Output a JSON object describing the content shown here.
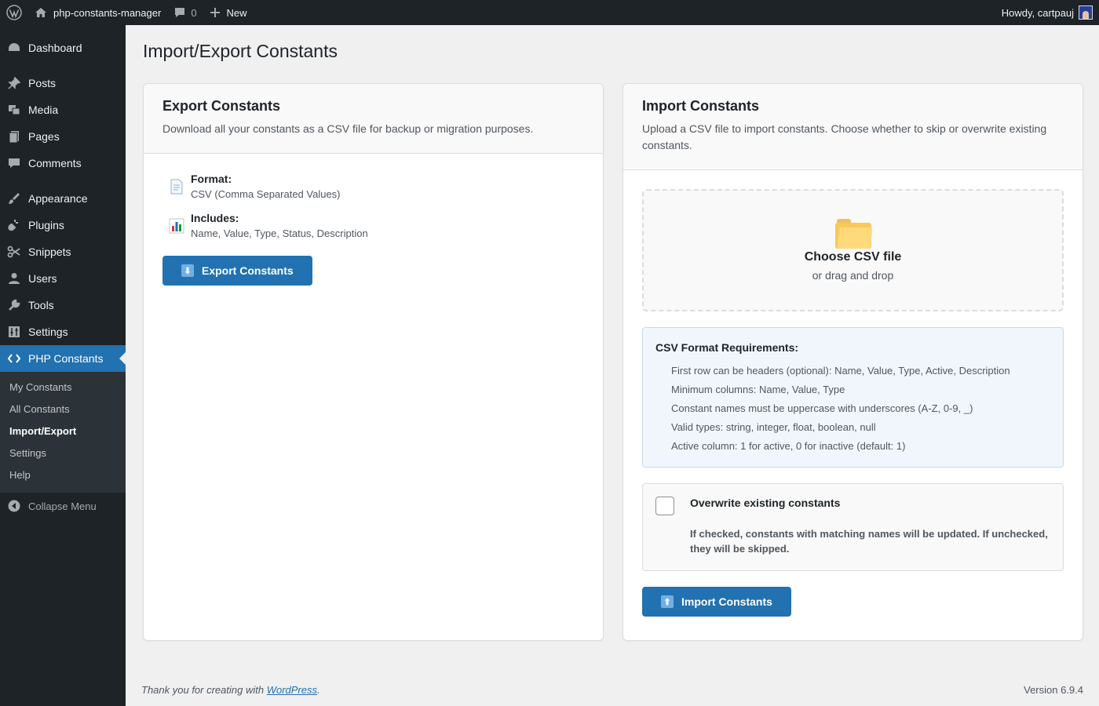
{
  "adminbar": {
    "site_name": "php-constants-manager",
    "comments_count": "0",
    "new_label": "New",
    "howdy": "Howdy, cartpauj"
  },
  "sidebar": {
    "items": [
      {
        "label": "Dashboard",
        "icon": "dashboard-icon"
      },
      {
        "label": "Posts",
        "icon": "pin-icon"
      },
      {
        "label": "Media",
        "icon": "media-icon"
      },
      {
        "label": "Pages",
        "icon": "pages-icon"
      },
      {
        "label": "Comments",
        "icon": "comment-icon"
      },
      {
        "label": "Appearance",
        "icon": "brush-icon"
      },
      {
        "label": "Plugins",
        "icon": "plugin-icon"
      },
      {
        "label": "Snippets",
        "icon": "scissors-icon"
      },
      {
        "label": "Users",
        "icon": "user-icon"
      },
      {
        "label": "Tools",
        "icon": "wrench-icon"
      },
      {
        "label": "Settings",
        "icon": "settings-icon"
      },
      {
        "label": "PHP Constants",
        "icon": "code-icon"
      }
    ],
    "submenu": [
      "My Constants",
      "All Constants",
      "Import/Export",
      "Settings",
      "Help"
    ],
    "collapse_label": "Collapse Menu"
  },
  "page": {
    "title": "Import/Export Constants"
  },
  "export": {
    "title": "Export Constants",
    "description": "Download all your constants as a CSV file for backup or migration purposes.",
    "format_label": "Format:",
    "format_value": "CSV (Comma Separated Values)",
    "includes_label": "Includes:",
    "includes_value": "Name, Value, Type, Status, Description",
    "button_label": "Export Constants"
  },
  "import": {
    "title": "Import Constants",
    "description": "Upload a CSV file to import constants. Choose whether to skip or overwrite existing constants.",
    "dropzone_title": "Choose CSV file",
    "dropzone_sub": "or drag and drop",
    "requirements_title": "CSV Format Requirements:",
    "requirements": [
      "First row can be headers (optional): Name, Value, Type, Active, Description",
      "Minimum columns: Name, Value, Type",
      "Constant names must be uppercase with underscores (A-Z, 0-9, _)",
      "Valid types: string, integer, float, boolean, null",
      "Active column: 1 for active, 0 for inactive (default: 1)"
    ],
    "overwrite_title": "Overwrite existing constants",
    "overwrite_desc": "If checked, constants with matching names will be updated. If unchecked, they will be skipped.",
    "button_label": "Import Constants"
  },
  "footer": {
    "thanks_prefix": "Thank you for creating with ",
    "thanks_link": "WordPress",
    "thanks_suffix": ".",
    "version": "Version 6.9.4"
  },
  "colors": {
    "accent": "#2271b1",
    "admin_dark": "#1d2327",
    "background": "#f0f0f1"
  }
}
